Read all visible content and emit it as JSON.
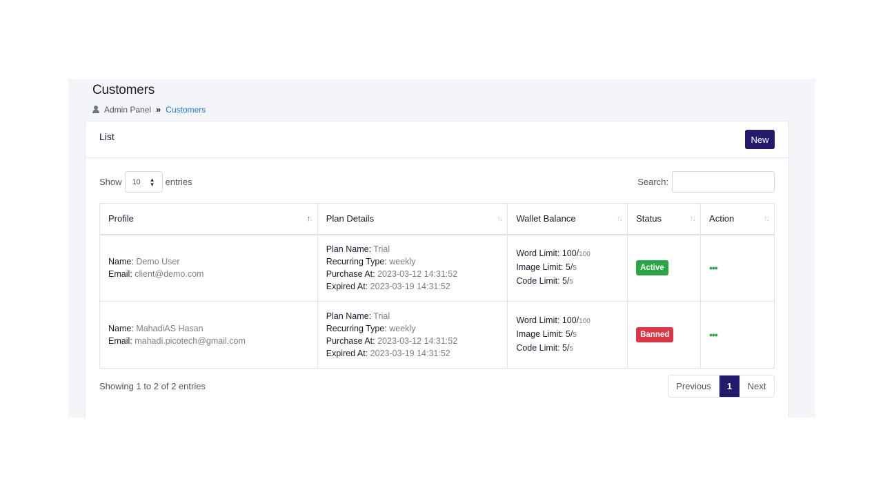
{
  "page": {
    "title": "Customers"
  },
  "breadcrumb": {
    "root": "Admin Panel",
    "separator": "»",
    "current": "Customers"
  },
  "card": {
    "title": "List",
    "new_button": "New"
  },
  "controls": {
    "show_label": "Show",
    "page_size": "10",
    "entries_label": "entries",
    "search_label": "Search:",
    "search_value": ""
  },
  "table": {
    "headers": [
      "Profile",
      "Plan Details",
      "Wallet Balance",
      "Status",
      "Action"
    ],
    "labels": {
      "name": "Name:",
      "email": "Email:",
      "plan_name": "Plan Name:",
      "recurring": "Recurring Type:",
      "purchase": "Purchase At:",
      "expired": "Expired At:",
      "word": "Word Limit:",
      "image": "Image Limit:",
      "code": "Code Limit:"
    },
    "rows": [
      {
        "name": "Demo User",
        "email": "client@demo.com",
        "plan_name": "Trial",
        "recurring": "weekly",
        "purchase": "2023-03-12 14:31:52",
        "expired": "2023-03-19 14:31:52",
        "word_used": "100",
        "word_total": "100",
        "image_used": "5",
        "image_total": "5",
        "code_used": "5",
        "code_total": "5",
        "status": "Active",
        "action": "•••"
      },
      {
        "name": "MahadiAS Hasan",
        "email": "mahadi.picotech@gmail.com",
        "plan_name": "Trial",
        "recurring": "weekly",
        "purchase": "2023-03-12 14:31:52",
        "expired": "2023-03-19 14:31:52",
        "word_used": "100",
        "word_total": "100",
        "image_used": "5",
        "image_total": "5",
        "code_used": "5",
        "code_total": "5",
        "status": "Banned",
        "action": "•••"
      }
    ]
  },
  "footer": {
    "info": "Showing 1 to 2 of 2 entries",
    "previous": "Previous",
    "current_page": "1",
    "next": "Next"
  },
  "colors": {
    "primary": "#231a6b",
    "active": "#28a745",
    "banned": "#dc3545",
    "link": "#1a73e8"
  }
}
